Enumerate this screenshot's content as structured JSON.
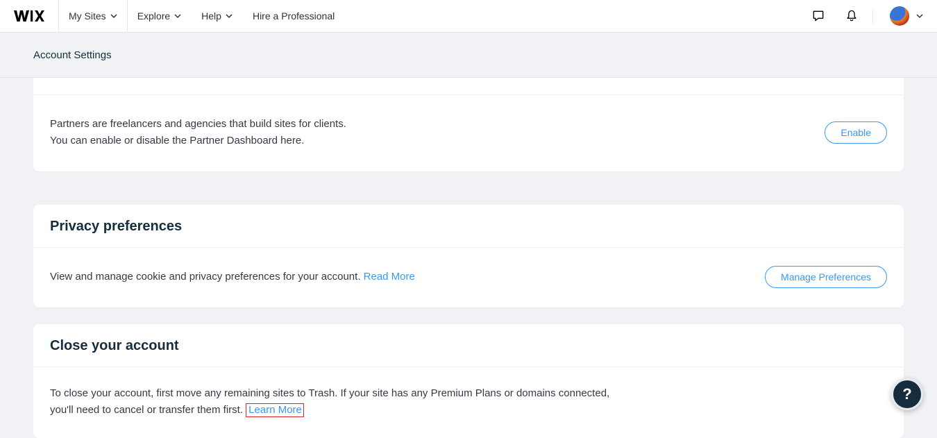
{
  "nav": {
    "logo": "WiX",
    "items": [
      {
        "label": "My Sites",
        "hasChevron": true
      },
      {
        "label": "Explore",
        "hasChevron": true
      },
      {
        "label": "Help",
        "hasChevron": true
      },
      {
        "label": "Hire a Professional",
        "hasChevron": false
      }
    ]
  },
  "subheader": {
    "title": "Account Settings"
  },
  "partner": {
    "line1": "Partners are freelancers and agencies that build sites for clients.",
    "line2": "You can enable or disable the Partner Dashboard here.",
    "button": "Enable"
  },
  "privacy": {
    "title": "Privacy preferences",
    "text": "View and manage cookie and privacy preferences for your account. ",
    "link": "Read More",
    "button": "Manage Preferences"
  },
  "close": {
    "title": "Close your account",
    "text": "To close your account, first move any remaining sites to Trash. If your site has any Premium Plans or domains connected, you'll need to cancel or transfer them first. ",
    "link": "Learn More"
  },
  "helpFab": "?"
}
